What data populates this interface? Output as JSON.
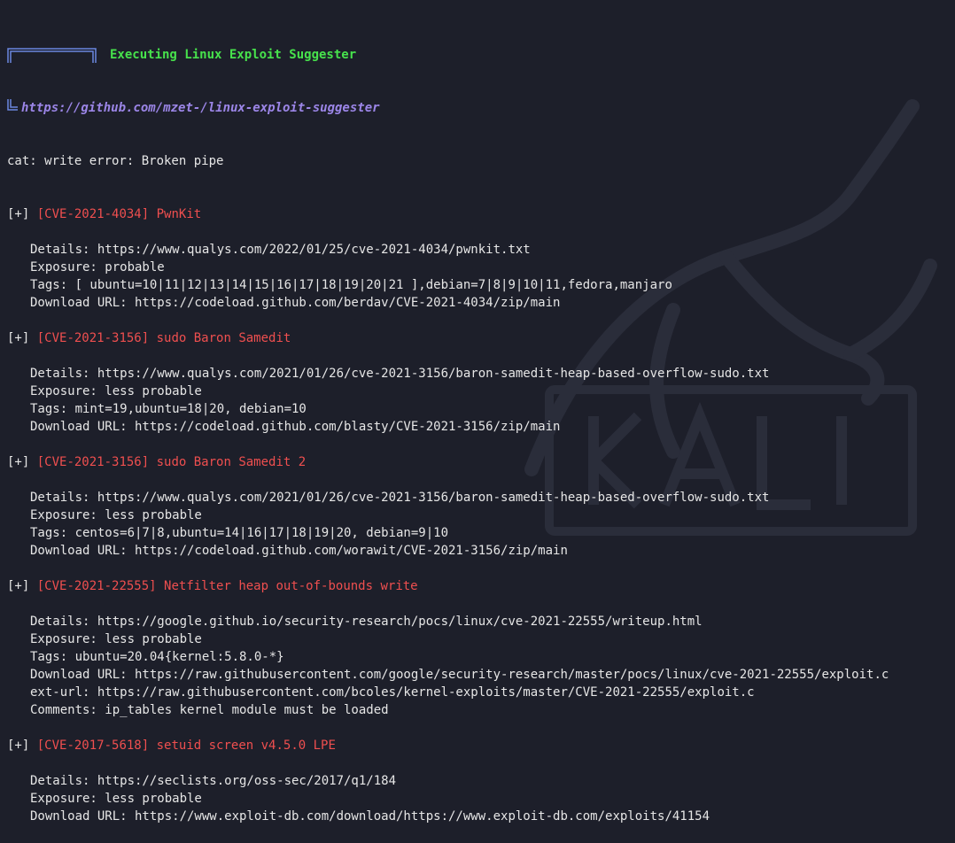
{
  "header": {
    "title": "Executing Linux Exploit Suggester",
    "url": "https://github.com/mzet-/linux-exploit-suggester"
  },
  "pre_output": "cat: write error: Broken pipe",
  "colors": {
    "background": "#1d1f2a",
    "text": "#e6e6e6",
    "title_green": "#47e24c",
    "url_purple": "#9c86e8",
    "cve_red": "#ef4f4f",
    "frame_blue": "#6b87e0"
  },
  "entries": [
    {
      "marker": "[+]",
      "cve": "[CVE-2021-4034]",
      "name": "PwnKit",
      "lines": [
        "Details: https://www.qualys.com/2022/01/25/cve-2021-4034/pwnkit.txt",
        "Exposure: probable",
        "Tags: [ ubuntu=10|11|12|13|14|15|16|17|18|19|20|21 ],debian=7|8|9|10|11,fedora,manjaro",
        "Download URL: https://codeload.github.com/berdav/CVE-2021-4034/zip/main"
      ]
    },
    {
      "marker": "[+]",
      "cve": "[CVE-2021-3156]",
      "name": "sudo Baron Samedit",
      "lines": [
        "Details: https://www.qualys.com/2021/01/26/cve-2021-3156/baron-samedit-heap-based-overflow-sudo.txt",
        "Exposure: less probable",
        "Tags: mint=19,ubuntu=18|20, debian=10",
        "Download URL: https://codeload.github.com/blasty/CVE-2021-3156/zip/main"
      ]
    },
    {
      "marker": "[+]",
      "cve": "[CVE-2021-3156]",
      "name": "sudo Baron Samedit 2",
      "lines": [
        "Details: https://www.qualys.com/2021/01/26/cve-2021-3156/baron-samedit-heap-based-overflow-sudo.txt",
        "Exposure: less probable",
        "Tags: centos=6|7|8,ubuntu=14|16|17|18|19|20, debian=9|10",
        "Download URL: https://codeload.github.com/worawit/CVE-2021-3156/zip/main"
      ]
    },
    {
      "marker": "[+]",
      "cve": "[CVE-2021-22555]",
      "name": "Netfilter heap out-of-bounds write",
      "lines": [
        "Details: https://google.github.io/security-research/pocs/linux/cve-2021-22555/writeup.html",
        "Exposure: less probable",
        "Tags: ubuntu=20.04{kernel:5.8.0-*}",
        "Download URL: https://raw.githubusercontent.com/google/security-research/master/pocs/linux/cve-2021-22555/exploit.c",
        "ext-url: https://raw.githubusercontent.com/bcoles/kernel-exploits/master/CVE-2021-22555/exploit.c",
        "Comments: ip_tables kernel module must be loaded"
      ]
    },
    {
      "marker": "[+]",
      "cve": "[CVE-2017-5618]",
      "name": "setuid screen v4.5.0 LPE",
      "lines": [
        "Details: https://seclists.org/oss-sec/2017/q1/184",
        "Exposure: less probable",
        "Download URL: https://www.exploit-db.com/download/https://www.exploit-db.com/exploits/41154"
      ]
    }
  ]
}
